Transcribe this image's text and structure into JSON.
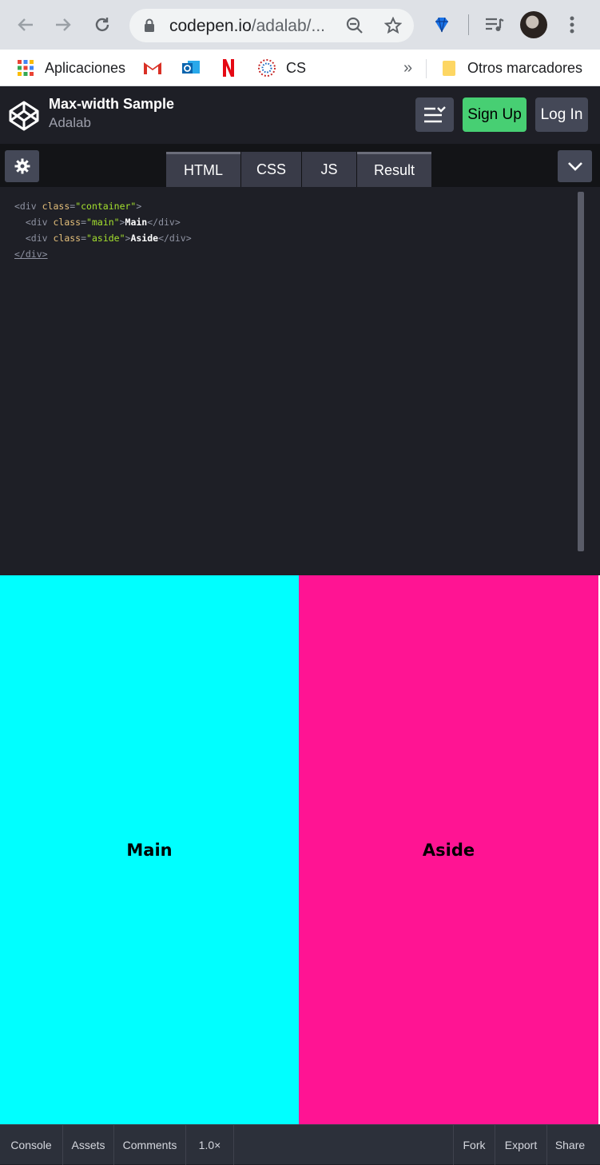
{
  "browser": {
    "url_main": "codepen.io",
    "url_rest": "/adalab/...",
    "bookmarks": {
      "apps": "Aplicaciones",
      "cs": "CS",
      "overflow": "»",
      "other": "Otros marcadores"
    }
  },
  "pen": {
    "title": "Max-width Sample",
    "user": "Adalab",
    "signup_label": "Sign Up",
    "login_label": "Log In"
  },
  "tabs": [
    {
      "label": "HTML"
    },
    {
      "label": "CSS"
    },
    {
      "label": "JS"
    },
    {
      "label": "Result"
    }
  ],
  "code": {
    "line1_open": "<div ",
    "line1_attr": "class",
    "line1_eq": "=",
    "line1_val": "\"container\"",
    "line1_close": ">",
    "line2_open": "<div ",
    "line2_attr": "class",
    "line2_eq": "=",
    "line2_val": "\"main\"",
    "line2_gt": ">",
    "line2_text": "Main",
    "line2_end": "</div>",
    "line3_open": "<div ",
    "line3_attr": "class",
    "line3_eq": "=",
    "line3_val": "\"aside\"",
    "line3_gt": ">",
    "line3_text": "Aside",
    "line3_end": "</div>",
    "line4": "</div>"
  },
  "result": {
    "main_label": "Main",
    "aside_label": "Aside",
    "main_color": "#00ffff",
    "aside_color": "#ff1493"
  },
  "footer": {
    "console": "Console",
    "assets": "Assets",
    "comments": "Comments",
    "zoom": "1.0×",
    "fork": "Fork",
    "export": "Export",
    "share": "Share"
  },
  "colors": {
    "signup": "#47cf73",
    "header_bg": "#1e1f26"
  }
}
